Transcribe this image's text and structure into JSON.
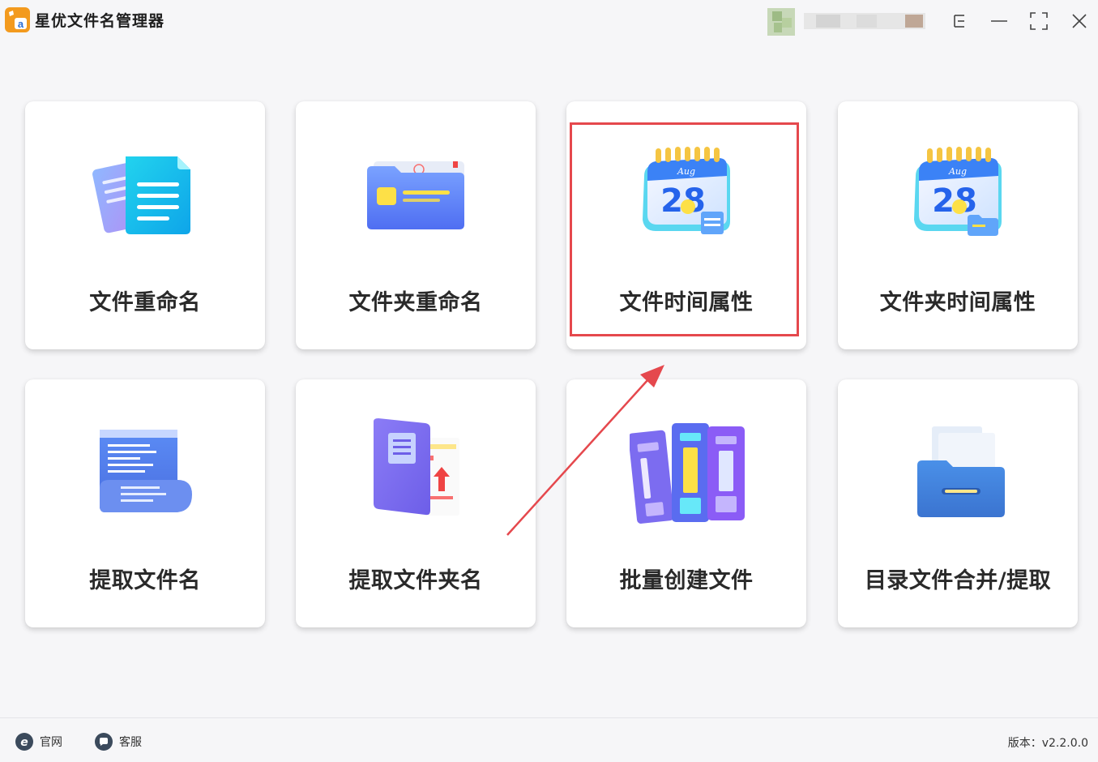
{
  "app": {
    "title": "星优文件名管理器",
    "logo_text": "a"
  },
  "cards": [
    {
      "label": "文件重命名",
      "icon": "document-stack-icon"
    },
    {
      "label": "文件夹重命名",
      "icon": "folder-icon"
    },
    {
      "label": "文件时间属性",
      "icon": "calendar-icon",
      "highlighted": true
    },
    {
      "label": "文件夹时间属性",
      "icon": "calendar-folder-icon"
    },
    {
      "label": "提取文件名",
      "icon": "scroll-list-icon"
    },
    {
      "label": "提取文件夹名",
      "icon": "book-upload-icon"
    },
    {
      "label": "批量创建文件",
      "icon": "binders-icon"
    },
    {
      "label": "目录文件合并/提取",
      "icon": "file-drawer-icon"
    }
  ],
  "calendar": {
    "month": "Aug",
    "day": "28"
  },
  "footer": {
    "website_label": "官网",
    "support_label": "客服",
    "version_text": "版本：v2.2.0.0"
  },
  "colors": {
    "accent": "#e5484d",
    "logo": "#f39a1e",
    "background": "#f6f6f8"
  }
}
